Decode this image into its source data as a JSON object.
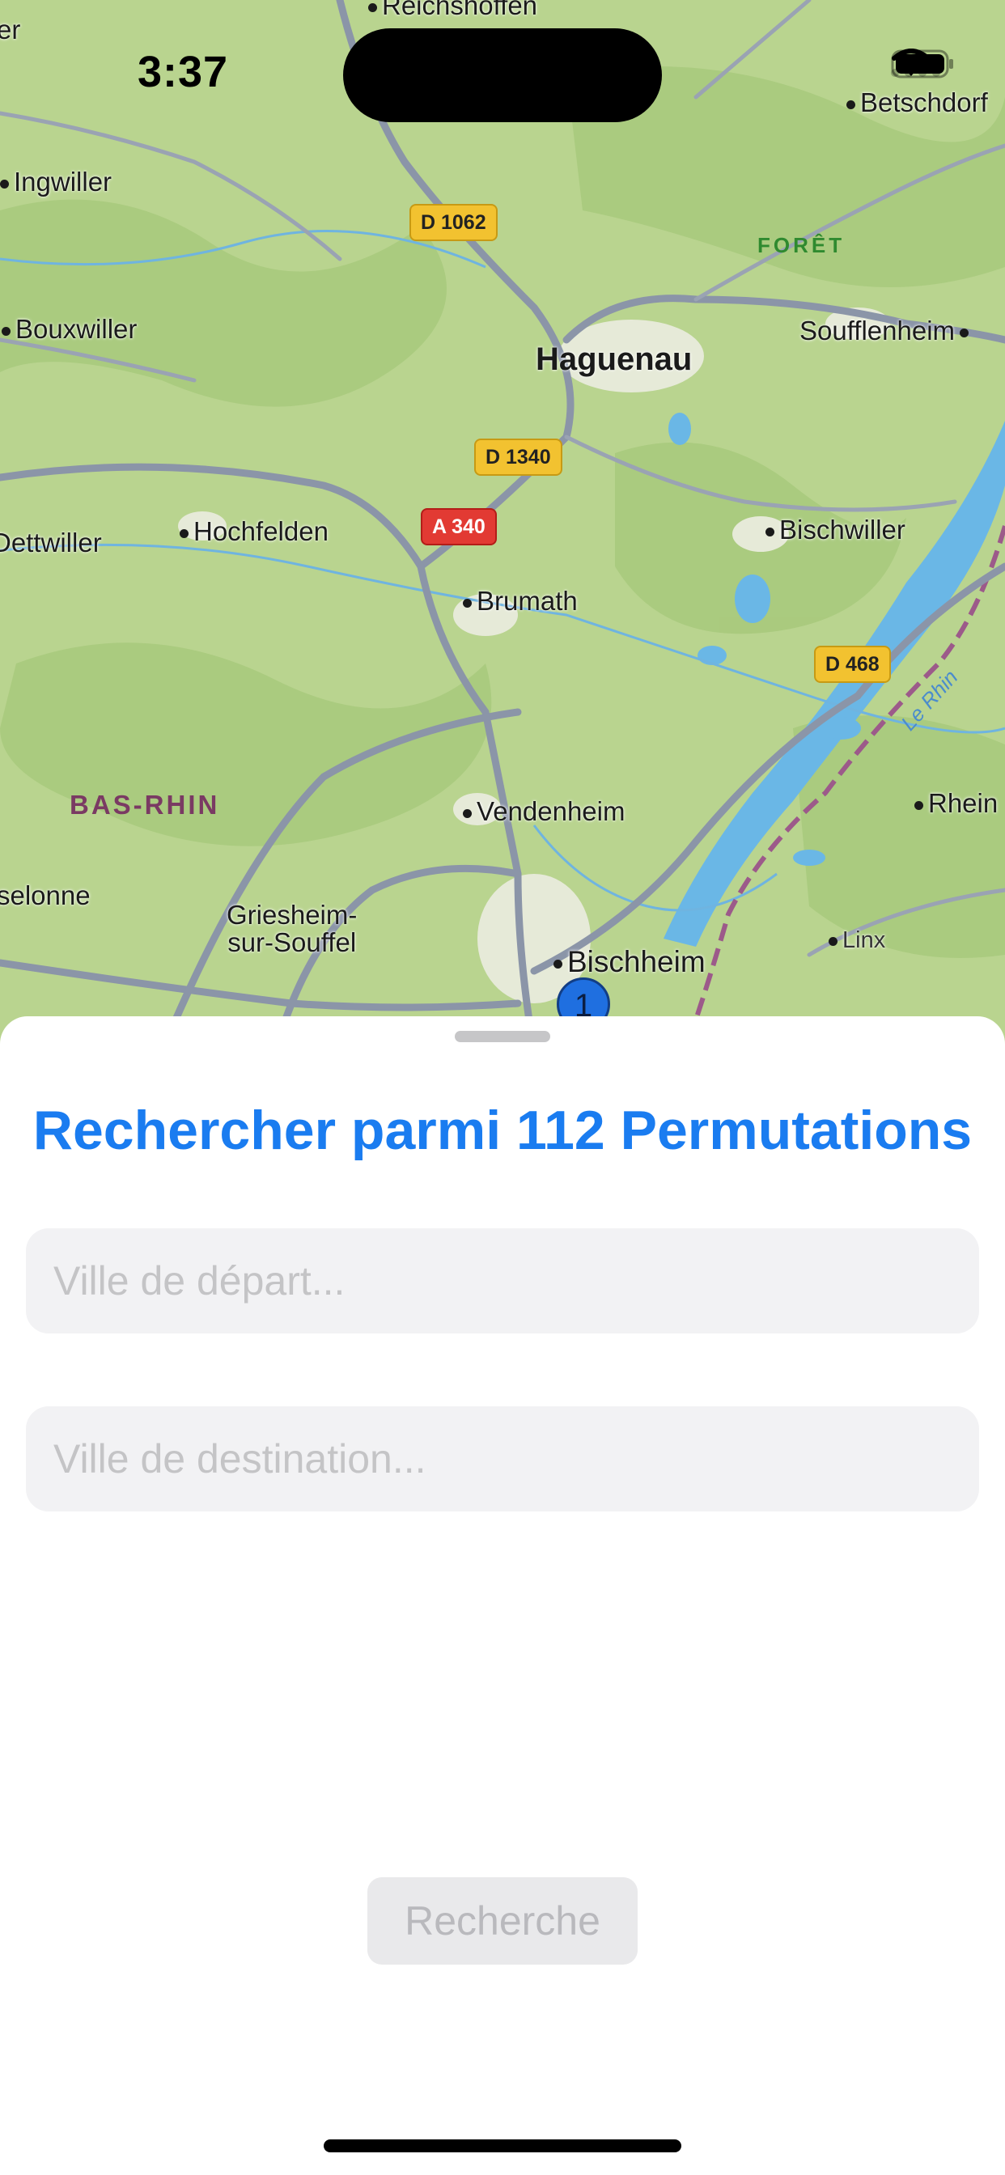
{
  "status_bar": {
    "time": "3:37"
  },
  "map": {
    "towns": [
      {
        "name": "Reichshoffen"
      },
      {
        "name": "Betschdorf"
      },
      {
        "name": "Ingwiller"
      },
      {
        "name": "Bouxwiller"
      },
      {
        "name": "Haguenau"
      },
      {
        "name": "Soufflenheim"
      },
      {
        "name": "Hochfelden"
      },
      {
        "name": "Dettwiller"
      },
      {
        "name": "Bischwiller"
      },
      {
        "name": "Brumath"
      },
      {
        "name": "Vendenheim"
      },
      {
        "name": "Rhein"
      },
      {
        "name": "Griesheim-\nsur-Souffel"
      },
      {
        "name": "Bischheim"
      },
      {
        "name": "Linx"
      },
      {
        "name": "selonne"
      },
      {
        "name": "er"
      }
    ],
    "region_label": "BAS-RHIN",
    "forest_label": "FORÊT",
    "river_label": "Le Rhin",
    "roads": [
      "D 1062",
      "D 1340",
      "A 340",
      "D 468"
    ],
    "marker_count": "1",
    "colors": {
      "land": "#b9d48f",
      "forest": "#a6c97a",
      "road": "#8b95a8",
      "water": "#6ab7e6"
    }
  },
  "sheet": {
    "title": "Rechercher parmi 112 Permutations",
    "departure_placeholder": "Ville de départ...",
    "destination_placeholder": "Ville de destination...",
    "search_button": "Recherche",
    "accent_color": "#1a7cf0"
  }
}
